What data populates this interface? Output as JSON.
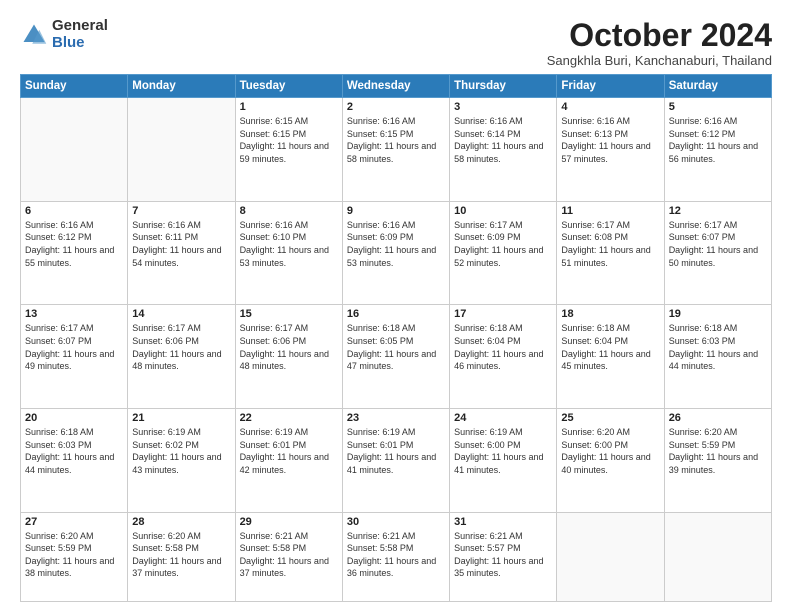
{
  "logo": {
    "general": "General",
    "blue": "Blue"
  },
  "header": {
    "month": "October 2024",
    "location": "Sangkhla Buri, Kanchanaburi, Thailand"
  },
  "weekdays": [
    "Sunday",
    "Monday",
    "Tuesday",
    "Wednesday",
    "Thursday",
    "Friday",
    "Saturday"
  ],
  "weeks": [
    [
      {
        "day": "",
        "sunrise": "",
        "sunset": "",
        "daylight": ""
      },
      {
        "day": "",
        "sunrise": "",
        "sunset": "",
        "daylight": ""
      },
      {
        "day": "1",
        "sunrise": "Sunrise: 6:15 AM",
        "sunset": "Sunset: 6:15 PM",
        "daylight": "Daylight: 11 hours and 59 minutes."
      },
      {
        "day": "2",
        "sunrise": "Sunrise: 6:16 AM",
        "sunset": "Sunset: 6:15 PM",
        "daylight": "Daylight: 11 hours and 58 minutes."
      },
      {
        "day": "3",
        "sunrise": "Sunrise: 6:16 AM",
        "sunset": "Sunset: 6:14 PM",
        "daylight": "Daylight: 11 hours and 58 minutes."
      },
      {
        "day": "4",
        "sunrise": "Sunrise: 6:16 AM",
        "sunset": "Sunset: 6:13 PM",
        "daylight": "Daylight: 11 hours and 57 minutes."
      },
      {
        "day": "5",
        "sunrise": "Sunrise: 6:16 AM",
        "sunset": "Sunset: 6:12 PM",
        "daylight": "Daylight: 11 hours and 56 minutes."
      }
    ],
    [
      {
        "day": "6",
        "sunrise": "Sunrise: 6:16 AM",
        "sunset": "Sunset: 6:12 PM",
        "daylight": "Daylight: 11 hours and 55 minutes."
      },
      {
        "day": "7",
        "sunrise": "Sunrise: 6:16 AM",
        "sunset": "Sunset: 6:11 PM",
        "daylight": "Daylight: 11 hours and 54 minutes."
      },
      {
        "day": "8",
        "sunrise": "Sunrise: 6:16 AM",
        "sunset": "Sunset: 6:10 PM",
        "daylight": "Daylight: 11 hours and 53 minutes."
      },
      {
        "day": "9",
        "sunrise": "Sunrise: 6:16 AM",
        "sunset": "Sunset: 6:09 PM",
        "daylight": "Daylight: 11 hours and 53 minutes."
      },
      {
        "day": "10",
        "sunrise": "Sunrise: 6:17 AM",
        "sunset": "Sunset: 6:09 PM",
        "daylight": "Daylight: 11 hours and 52 minutes."
      },
      {
        "day": "11",
        "sunrise": "Sunrise: 6:17 AM",
        "sunset": "Sunset: 6:08 PM",
        "daylight": "Daylight: 11 hours and 51 minutes."
      },
      {
        "day": "12",
        "sunrise": "Sunrise: 6:17 AM",
        "sunset": "Sunset: 6:07 PM",
        "daylight": "Daylight: 11 hours and 50 minutes."
      }
    ],
    [
      {
        "day": "13",
        "sunrise": "Sunrise: 6:17 AM",
        "sunset": "Sunset: 6:07 PM",
        "daylight": "Daylight: 11 hours and 49 minutes."
      },
      {
        "day": "14",
        "sunrise": "Sunrise: 6:17 AM",
        "sunset": "Sunset: 6:06 PM",
        "daylight": "Daylight: 11 hours and 48 minutes."
      },
      {
        "day": "15",
        "sunrise": "Sunrise: 6:17 AM",
        "sunset": "Sunset: 6:06 PM",
        "daylight": "Daylight: 11 hours and 48 minutes."
      },
      {
        "day": "16",
        "sunrise": "Sunrise: 6:18 AM",
        "sunset": "Sunset: 6:05 PM",
        "daylight": "Daylight: 11 hours and 47 minutes."
      },
      {
        "day": "17",
        "sunrise": "Sunrise: 6:18 AM",
        "sunset": "Sunset: 6:04 PM",
        "daylight": "Daylight: 11 hours and 46 minutes."
      },
      {
        "day": "18",
        "sunrise": "Sunrise: 6:18 AM",
        "sunset": "Sunset: 6:04 PM",
        "daylight": "Daylight: 11 hours and 45 minutes."
      },
      {
        "day": "19",
        "sunrise": "Sunrise: 6:18 AM",
        "sunset": "Sunset: 6:03 PM",
        "daylight": "Daylight: 11 hours and 44 minutes."
      }
    ],
    [
      {
        "day": "20",
        "sunrise": "Sunrise: 6:18 AM",
        "sunset": "Sunset: 6:03 PM",
        "daylight": "Daylight: 11 hours and 44 minutes."
      },
      {
        "day": "21",
        "sunrise": "Sunrise: 6:19 AM",
        "sunset": "Sunset: 6:02 PM",
        "daylight": "Daylight: 11 hours and 43 minutes."
      },
      {
        "day": "22",
        "sunrise": "Sunrise: 6:19 AM",
        "sunset": "Sunset: 6:01 PM",
        "daylight": "Daylight: 11 hours and 42 minutes."
      },
      {
        "day": "23",
        "sunrise": "Sunrise: 6:19 AM",
        "sunset": "Sunset: 6:01 PM",
        "daylight": "Daylight: 11 hours and 41 minutes."
      },
      {
        "day": "24",
        "sunrise": "Sunrise: 6:19 AM",
        "sunset": "Sunset: 6:00 PM",
        "daylight": "Daylight: 11 hours and 41 minutes."
      },
      {
        "day": "25",
        "sunrise": "Sunrise: 6:20 AM",
        "sunset": "Sunset: 6:00 PM",
        "daylight": "Daylight: 11 hours and 40 minutes."
      },
      {
        "day": "26",
        "sunrise": "Sunrise: 6:20 AM",
        "sunset": "Sunset: 5:59 PM",
        "daylight": "Daylight: 11 hours and 39 minutes."
      }
    ],
    [
      {
        "day": "27",
        "sunrise": "Sunrise: 6:20 AM",
        "sunset": "Sunset: 5:59 PM",
        "daylight": "Daylight: 11 hours and 38 minutes."
      },
      {
        "day": "28",
        "sunrise": "Sunrise: 6:20 AM",
        "sunset": "Sunset: 5:58 PM",
        "daylight": "Daylight: 11 hours and 37 minutes."
      },
      {
        "day": "29",
        "sunrise": "Sunrise: 6:21 AM",
        "sunset": "Sunset: 5:58 PM",
        "daylight": "Daylight: 11 hours and 37 minutes."
      },
      {
        "day": "30",
        "sunrise": "Sunrise: 6:21 AM",
        "sunset": "Sunset: 5:58 PM",
        "daylight": "Daylight: 11 hours and 36 minutes."
      },
      {
        "day": "31",
        "sunrise": "Sunrise: 6:21 AM",
        "sunset": "Sunset: 5:57 PM",
        "daylight": "Daylight: 11 hours and 35 minutes."
      },
      {
        "day": "",
        "sunrise": "",
        "sunset": "",
        "daylight": ""
      },
      {
        "day": "",
        "sunrise": "",
        "sunset": "",
        "daylight": ""
      }
    ]
  ]
}
